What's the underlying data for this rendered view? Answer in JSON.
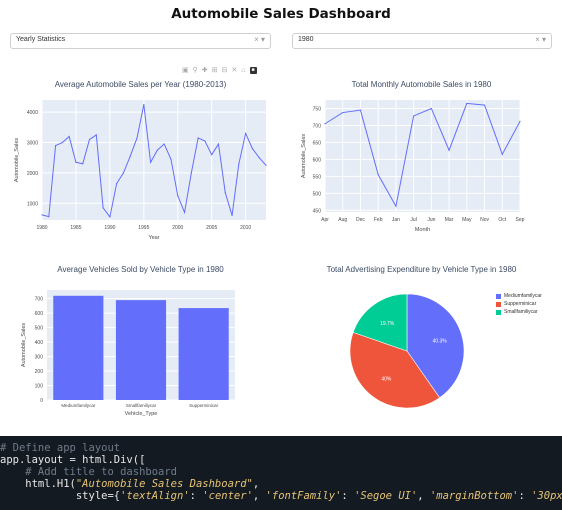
{
  "header": {
    "title": "Automobile Sales Dashboard"
  },
  "dropdowns": {
    "stat": {
      "value": "Yearly Statistics"
    },
    "year": {
      "value": "1980"
    }
  },
  "controls": {
    "clear": "×",
    "caret": "▾"
  },
  "modebar": {
    "icons": [
      "camera-icon",
      "zoom-icon",
      "pan-icon",
      "zoom-in-icon",
      "zoom-out-icon",
      "autoscale-icon",
      "reset-icon",
      "plotly-logo"
    ]
  },
  "charts": {
    "yearly": {
      "title": "Average Automobile Sales per Year (1980-2013)",
      "xlabel": "Year",
      "ylabel": "Automobile_Sales",
      "xticks": [
        "1980",
        "1985",
        "1990",
        "1995",
        "2000",
        "2005",
        "2010"
      ],
      "yticks": [
        "1000",
        "2000",
        "3000",
        "4000"
      ]
    },
    "monthly": {
      "title": "Total Monthly Automobile Sales in 1980",
      "xlabel": "Month",
      "ylabel": "Automobile_Sales",
      "xticks": [
        "Apr",
        "Aug",
        "Dec",
        "Feb",
        "Jan",
        "Jul",
        "Jun",
        "Mar",
        "May",
        "Nov",
        "Oct",
        "Sep"
      ],
      "yticks": [
        "450",
        "500",
        "550",
        "600",
        "650",
        "700",
        "750"
      ]
    },
    "bar": {
      "title": "Average Vehicles Sold by Vehicle Type in 1980",
      "xlabel": "Vehicle_Type",
      "ylabel": "Automobile_Sales",
      "yticks": [
        "0",
        "100",
        "200",
        "300",
        "400",
        "500",
        "600",
        "700"
      ]
    },
    "pie": {
      "title": "Total Advertising Expenditure by Vehicle Type in 1980"
    }
  },
  "chart_data": [
    {
      "type": "line",
      "title": "Average Automobile Sales per Year (1980-2013)",
      "xlabel": "Year",
      "ylabel": "Automobile_Sales",
      "x": [
        1980,
        1981,
        1982,
        1983,
        1984,
        1985,
        1986,
        1987,
        1988,
        1989,
        1990,
        1991,
        1992,
        1993,
        1994,
        1995,
        1996,
        1997,
        1998,
        1999,
        2000,
        2001,
        2002,
        2003,
        2004,
        2005,
        2006,
        2007,
        2008,
        2009,
        2010,
        2011,
        2012,
        2013
      ],
      "y": [
        620,
        560,
        2900,
        3000,
        3200,
        2350,
        2300,
        3100,
        3250,
        850,
        550,
        1650,
        2000,
        2550,
        3150,
        4250,
        2350,
        2750,
        2950,
        2450,
        1250,
        700,
        2000,
        3150,
        3050,
        2600,
        2950,
        1350,
        600,
        2300,
        3300,
        2800,
        2500,
        2250
      ],
      "xlim": [
        1980,
        2013
      ],
      "ylim": [
        450,
        4400
      ],
      "color": "#636efa"
    },
    {
      "type": "line",
      "title": "Total Monthly Automobile Sales in 1980",
      "xlabel": "Month",
      "ylabel": "Automobile_Sales",
      "categories": [
        "Apr",
        "Aug",
        "Dec",
        "Feb",
        "Jan",
        "Jul",
        "Jun",
        "Mar",
        "May",
        "Nov",
        "Oct",
        "Sep"
      ],
      "values": [
        705,
        738,
        745,
        555,
        462,
        728,
        750,
        627,
        765,
        760,
        615,
        712
      ],
      "ylim": [
        445,
        775
      ],
      "color": "#636efa"
    },
    {
      "type": "bar",
      "title": "Average Vehicles Sold by Vehicle Type in 1980",
      "xlabel": "Vehicle_Type",
      "ylabel": "Automobile_Sales",
      "categories": [
        "Mediumfamilycar",
        "Smallfamiliycar",
        "Supperminicar"
      ],
      "values": [
        720,
        690,
        635
      ],
      "ylim": [
        0,
        760
      ],
      "color": "#636efa"
    },
    {
      "type": "pie",
      "title": "Total Advertising Expenditure by Vehicle Type in 1980",
      "categories": [
        "Mediumfamilycar",
        "Supperminicar",
        "Smallfamiliycar"
      ],
      "values": [
        40.3,
        40.0,
        19.7
      ],
      "labels": [
        "40.3%",
        "40%",
        "19.7%"
      ],
      "colors": [
        "#636efa",
        "#ef553b",
        "#00cc96"
      ],
      "legend": "right"
    }
  ],
  "code": {
    "line1": "# Define app layout",
    "line2a": "app.layout = html.Div([",
    "line3": "    # Add title to dashboard",
    "line4a": "    html.H1(",
    "line4b": "\"Automobile Sales Dashboard\"",
    "line4c": ",",
    "line5a": "            style={",
    "line5b": "'textAlign'",
    "line5c": ": ",
    "line5d": "'center'",
    "line5e": ", ",
    "line5f": "'fontFamily'",
    "line5g": ": ",
    "line5h": "'Segoe UI'",
    "line5i": ", ",
    "line5j": "'marginBottom'",
    "line5k": ": ",
    "line5l": "'30px'",
    "line5m": "}),"
  }
}
